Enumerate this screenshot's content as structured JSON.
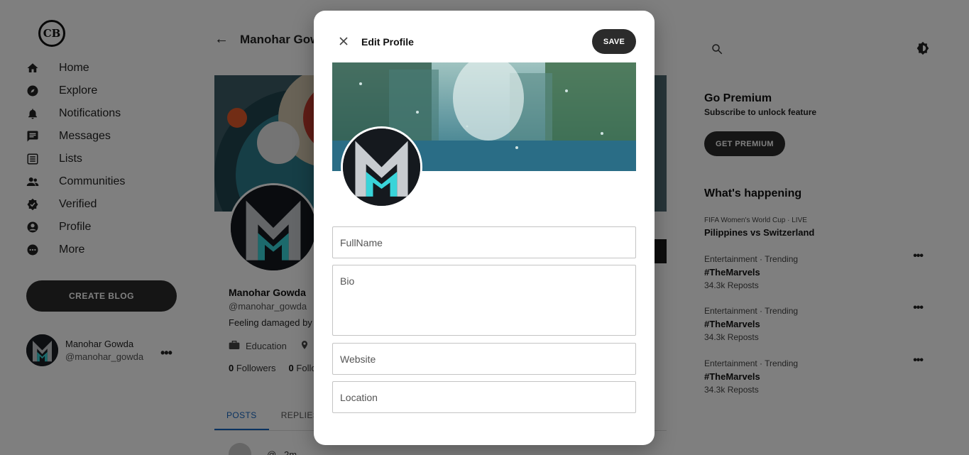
{
  "app": {
    "logo_text": "CB"
  },
  "sidebar": {
    "items": [
      {
        "label": "Home",
        "icon": "home-icon"
      },
      {
        "label": "Explore",
        "icon": "compass-icon"
      },
      {
        "label": "Notifications",
        "icon": "bell-icon"
      },
      {
        "label": "Messages",
        "icon": "message-icon"
      },
      {
        "label": "Lists",
        "icon": "list-icon"
      },
      {
        "label": "Communities",
        "icon": "people-icon"
      },
      {
        "label": "Verified",
        "icon": "verified-icon"
      },
      {
        "label": "Profile",
        "icon": "profile-icon"
      },
      {
        "label": "More",
        "icon": "more-icon"
      }
    ],
    "create_button": "CREATE BLOG",
    "user": {
      "name": "Manohar Gowda",
      "handle": "@manohar_gowda"
    }
  },
  "profile": {
    "header_title": "Manohar Gowda",
    "name": "Manohar Gowda",
    "handle": "@manohar_gowda",
    "bio": "Feeling damaged by l",
    "profession": "Education",
    "followers_count": "0",
    "followers_label": "Followers",
    "following_count": "0",
    "following_label": "Follo",
    "tabs": [
      "POSTS",
      "REPLIES"
    ],
    "post_peek": "@ . 2m"
  },
  "right": {
    "premium_title": "Go Premium",
    "premium_subtitle": "Subscribe to unlock feature",
    "premium_button": "GET PREMIUM",
    "happening_title": "What's happening",
    "trends": [
      {
        "category": "FIFA Women's World Cup · LIVE",
        "name": "Pilippines vs Switzerland",
        "count": ""
      },
      {
        "category": "Entertainment · Trending",
        "name": "#TheMarvels",
        "count": "34.3k Reposts"
      },
      {
        "category": "Entertainment · Trending",
        "name": "#TheMarvels",
        "count": "34.3k Reposts"
      },
      {
        "category": "Entertainment · Trending",
        "name": "#TheMarvels",
        "count": "34.3k Reposts"
      }
    ]
  },
  "modal": {
    "title": "Edit Profile",
    "save_label": "SAVE",
    "fields": {
      "fullname_placeholder": "FullName",
      "bio_placeholder": "Bio",
      "website_placeholder": "Website",
      "location_placeholder": "Location"
    }
  },
  "colors": {
    "overlay": "#00000080",
    "dark_button": "#2b2b2b",
    "active_tab": "#1565c0"
  }
}
